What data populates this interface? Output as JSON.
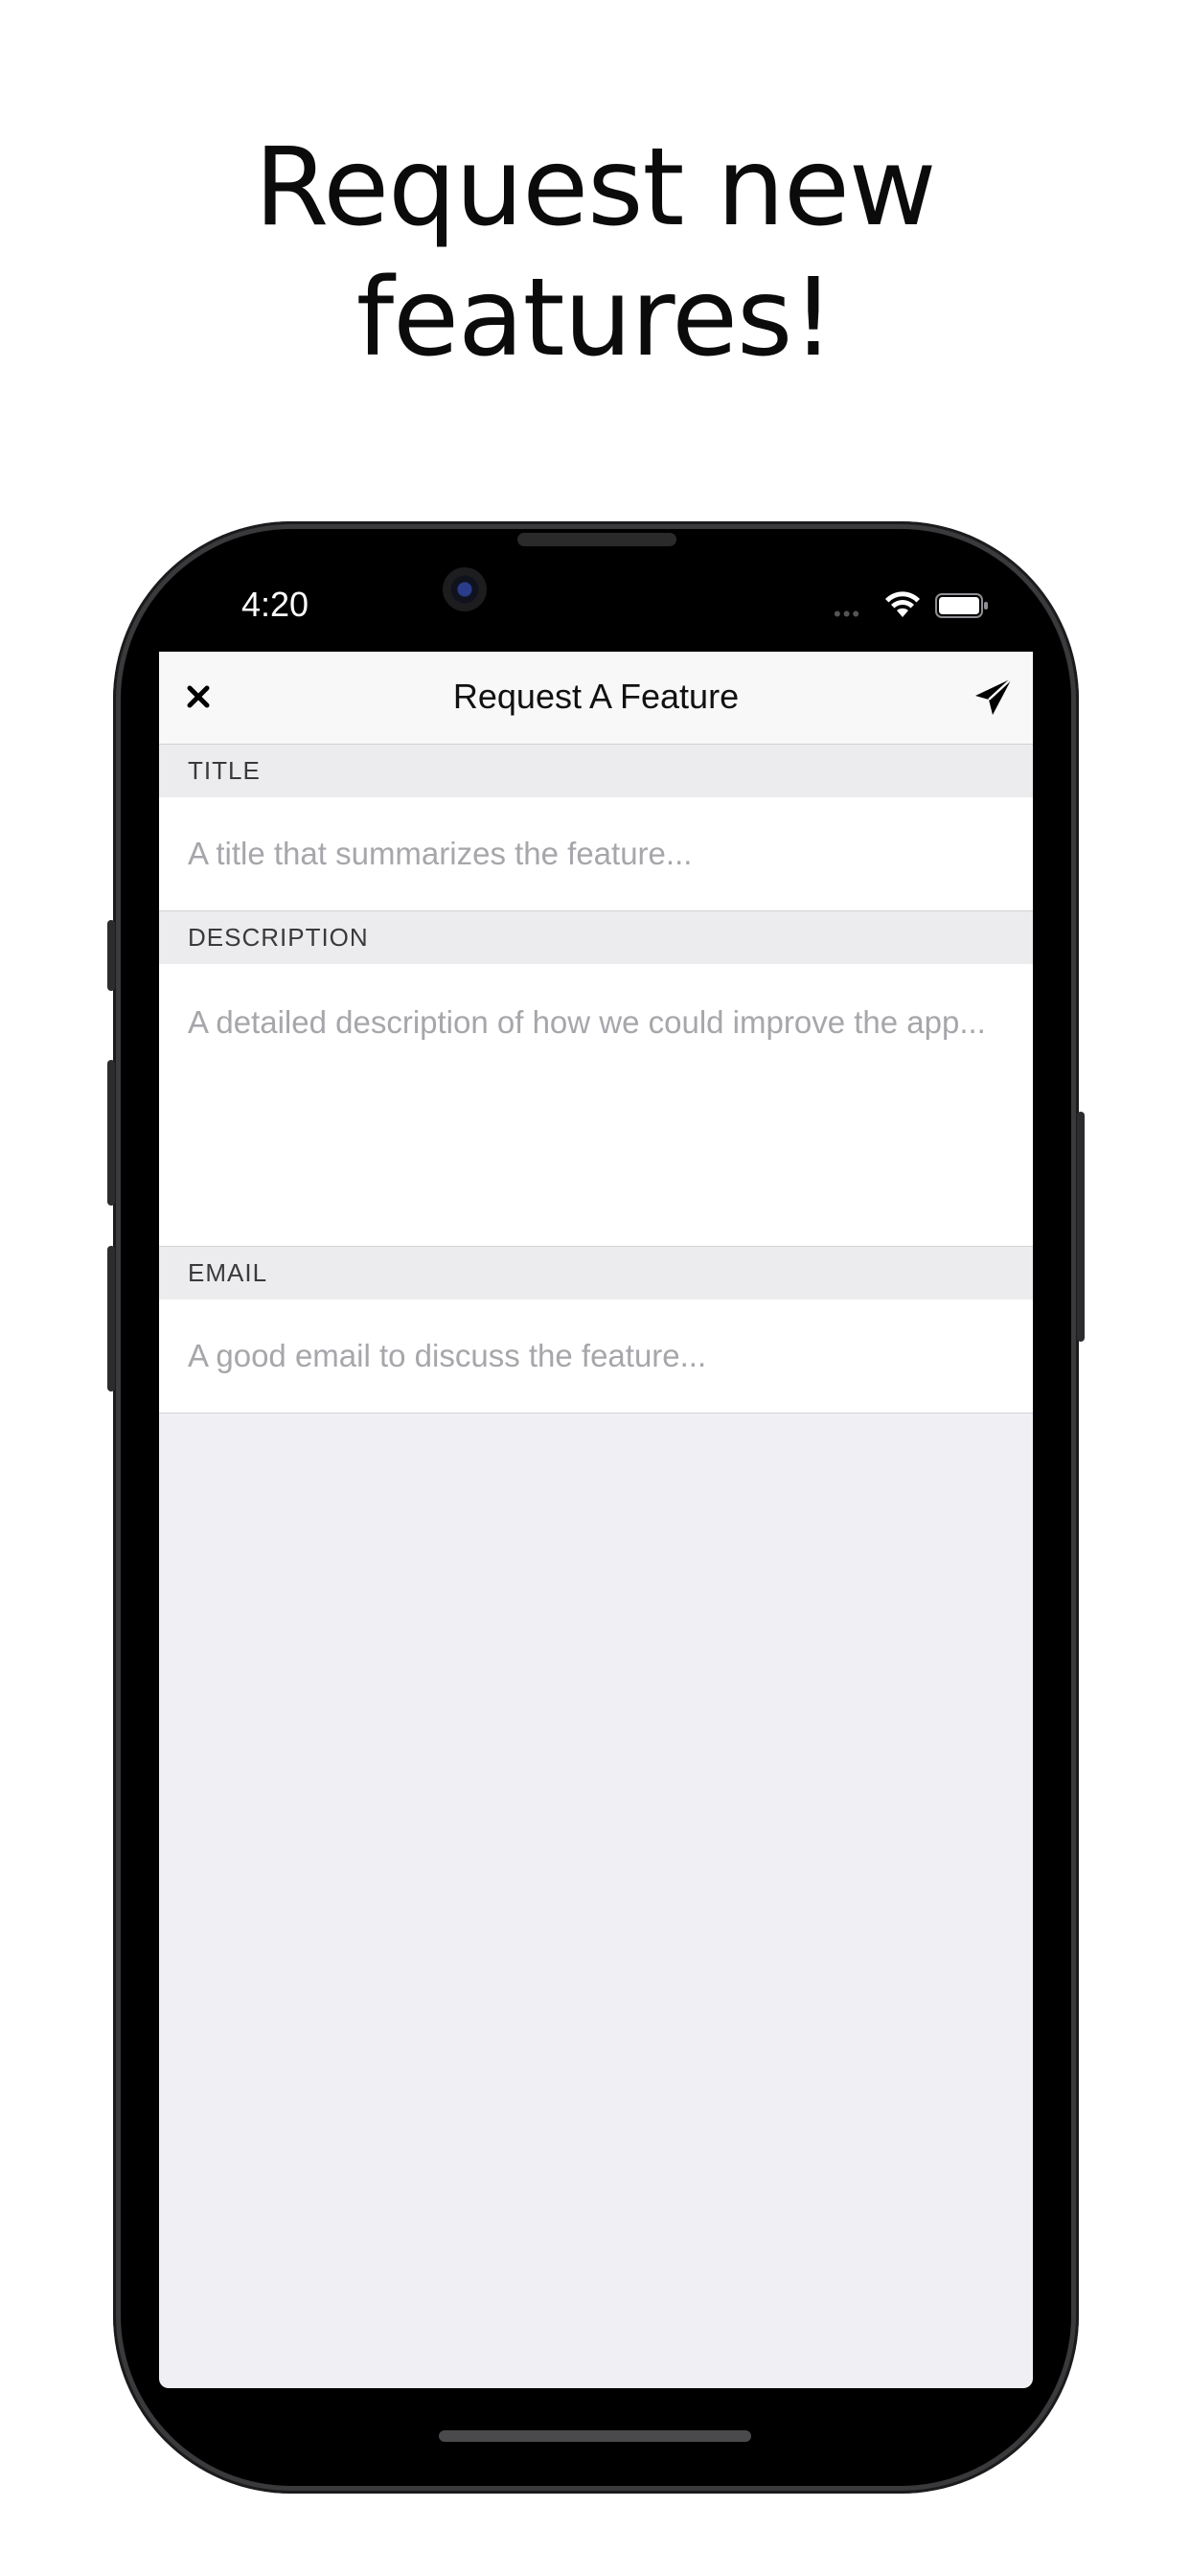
{
  "headline": {
    "line1": "Request new",
    "line2": "features!"
  },
  "status_bar": {
    "time": "4:20"
  },
  "nav": {
    "title": "Request A Feature",
    "close_icon": "close-icon",
    "send_icon": "paper-plane-icon"
  },
  "form": {
    "title_section": {
      "header": "TITLE",
      "placeholder": "A title that summarizes the feature...",
      "value": ""
    },
    "description_section": {
      "header": "DESCRIPTION",
      "placeholder": "A detailed description of how we could improve the app...",
      "value": ""
    },
    "email_section": {
      "header": "EMAIL",
      "placeholder": "A good email to discuss the feature...",
      "value": ""
    }
  },
  "colors": {
    "background_grouped": "#efeff4",
    "section_header_bg": "#ececee",
    "placeholder": "#a6a6ab"
  }
}
